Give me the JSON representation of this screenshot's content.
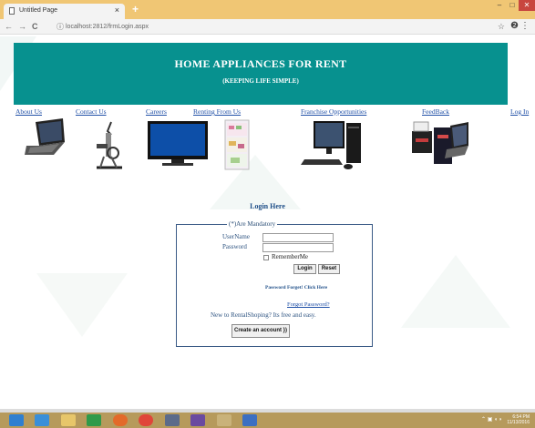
{
  "browser": {
    "tab_title": "Untitled Page",
    "tab_close": "×",
    "new_tab": "+",
    "url": "localhost:2812/frmLogin.aspx",
    "controls": {
      "minimize": "–",
      "maximize": "□",
      "close": "✕"
    },
    "back": "←",
    "forward": "→",
    "reload": "C",
    "star": "☆",
    "account": "❷",
    "menu": "⋮",
    "info": "ⓘ"
  },
  "header": {
    "title": "HOME APPLIANCES FOR RENT",
    "subtitle": "(KEEPING LIFE SIMPLE)"
  },
  "nav": {
    "items": [
      {
        "label": "About Us"
      },
      {
        "label": "Contact Us"
      },
      {
        "label": "Careers"
      },
      {
        "label": "Renting From Us"
      },
      {
        "label": "Franchise Opportunities"
      },
      {
        "label": "FeedBack"
      },
      {
        "label": "Log In"
      }
    ]
  },
  "login": {
    "heading": "Login Here",
    "legend": "(*)Are Mandatory",
    "username_label": "UserName",
    "password_label": "Password",
    "username_value": "",
    "password_value": "",
    "remember_label": "RememberMe",
    "login_button": "Login",
    "reset_button": "Reset",
    "forgot_bold": "Password Forget! Click Here",
    "forgot_link": "Forgot Password?",
    "new_to": "New to RentalShoping? Its free and easy.",
    "create_button": "Create an account })"
  },
  "taskbar": {
    "time": "6:54 PM",
    "date": "11/13/2016"
  },
  "colors": {
    "banner": "#07918f",
    "link": "#1f4fa6",
    "tabbar": "#f0c674",
    "taskbar": "#b69a5c"
  }
}
